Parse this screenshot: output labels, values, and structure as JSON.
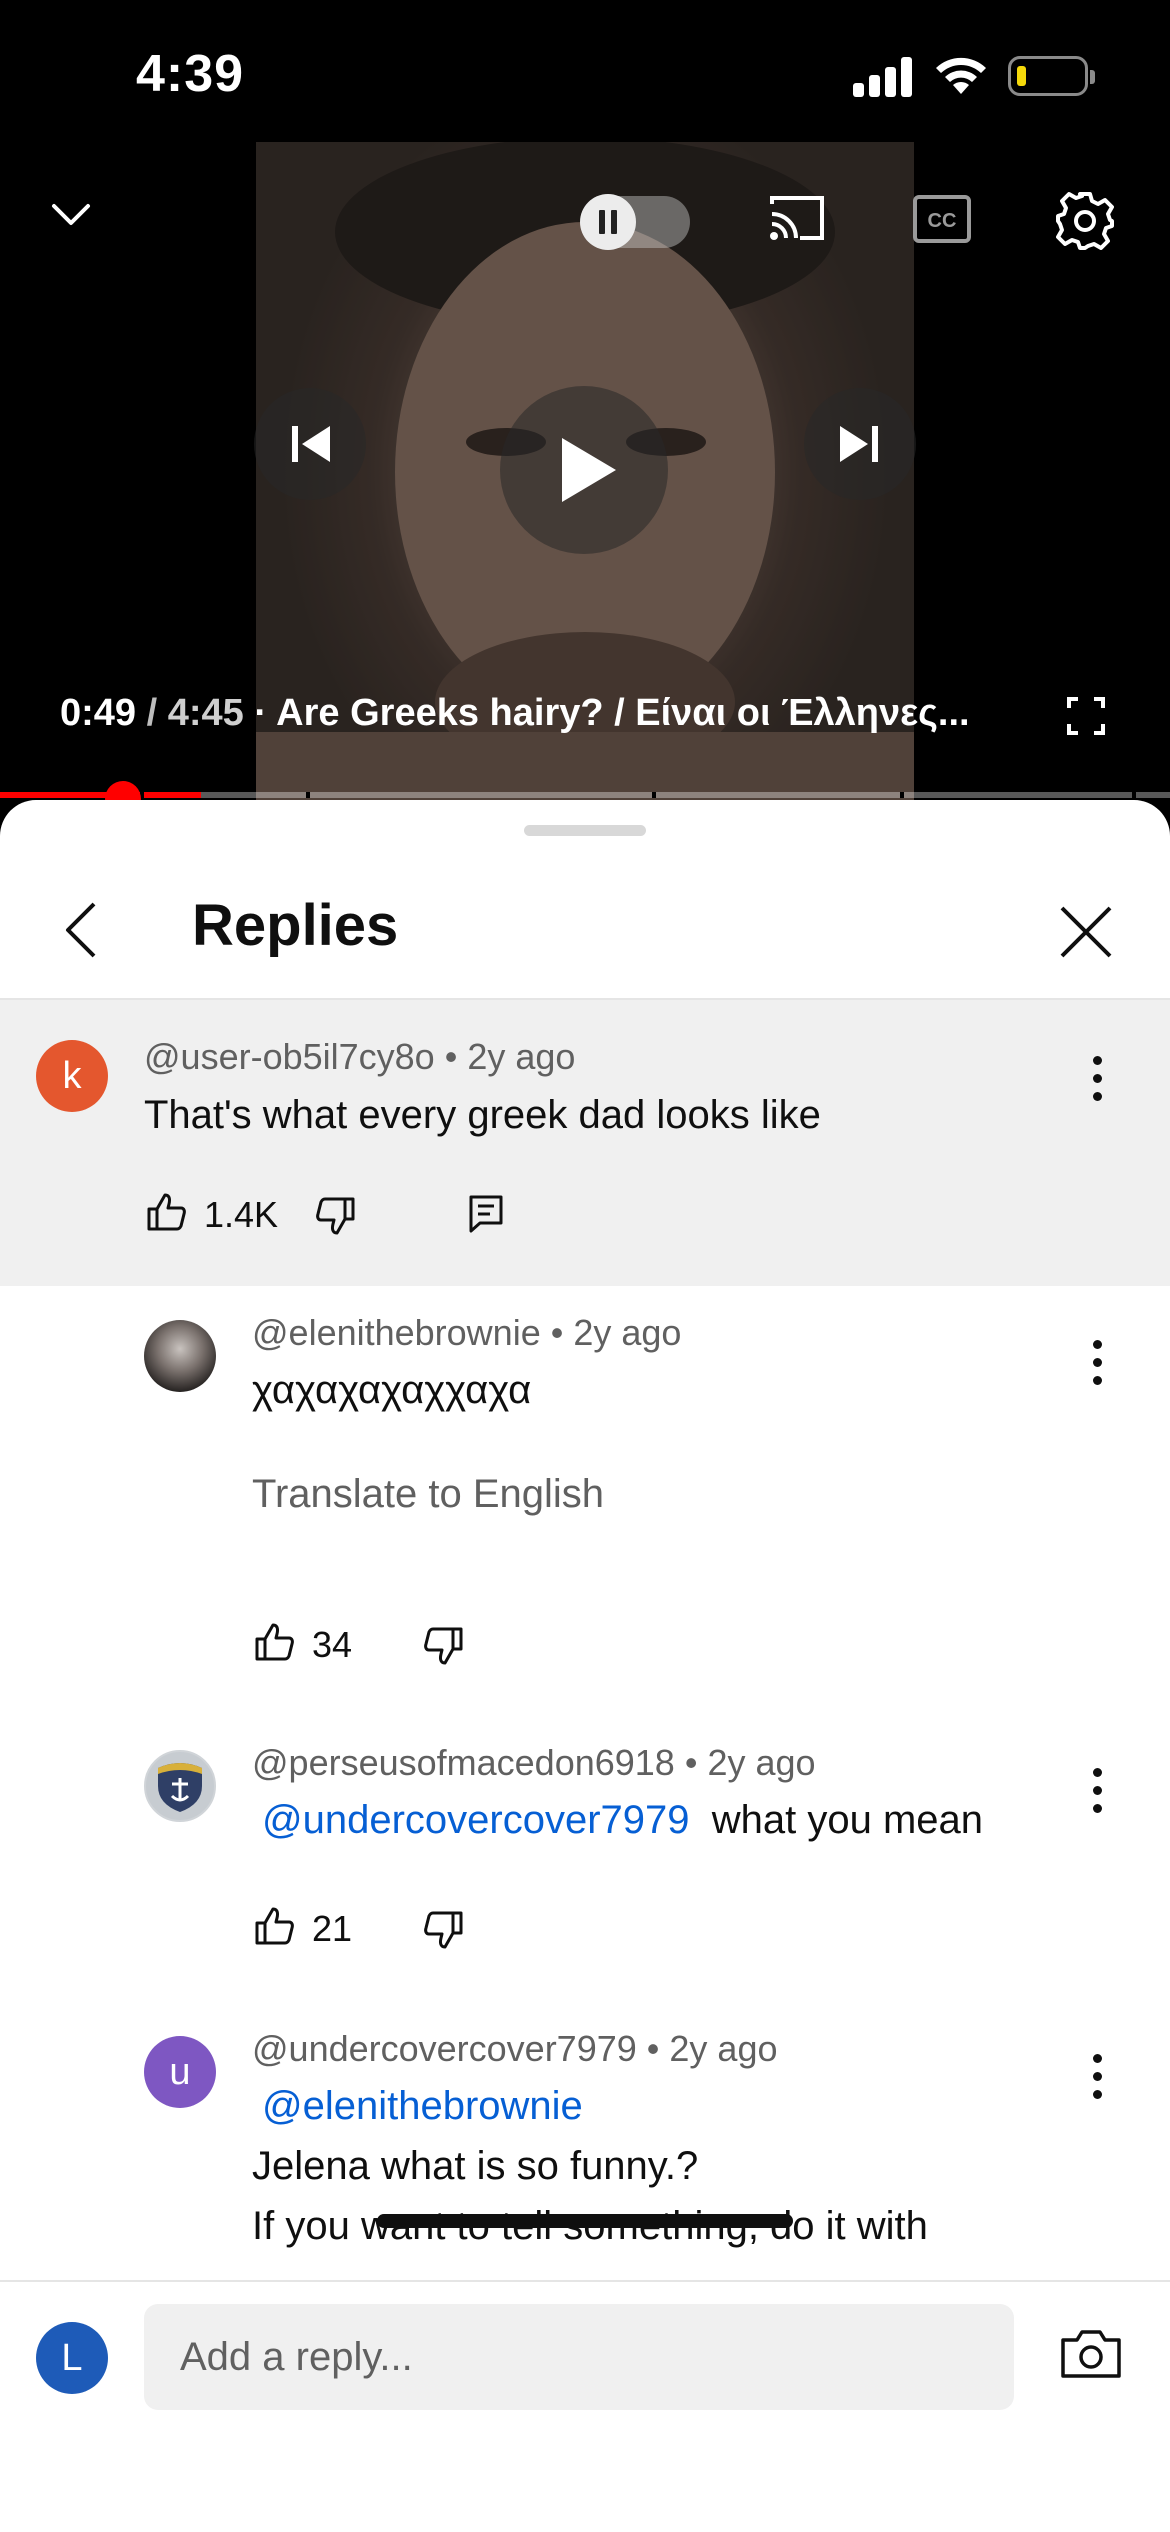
{
  "status_bar": {
    "time": "4:39"
  },
  "player": {
    "current_time": "0:49",
    "separator": "/",
    "duration": "4:45",
    "title": "· Are Greeks hairy? / Είναι οι Έλληνες...",
    "progress_fraction": 0.172,
    "autoplay": "paused",
    "icons": [
      "chevron-down-icon",
      "autoplay-toggle-icon",
      "cast-icon",
      "captions-icon",
      "settings-icon",
      "previous-icon",
      "play-icon",
      "next-icon",
      "fullscreen-icon"
    ],
    "accent_color": "#ff0000"
  },
  "sheet": {
    "title": "Replies",
    "icons": [
      "back-arrow-icon",
      "close-icon"
    ]
  },
  "parent_comment": {
    "avatar_letter": "k",
    "avatar_color": "#e4572e",
    "author": "@user-ob5il7cy8o",
    "age": "• 2y ago",
    "text": "That's what every greek dad looks like",
    "likes": "1.4K"
  },
  "replies": [
    {
      "author": "@elenithebrownie",
      "age": "• 2y ago",
      "text": "χαχαχαχαχχαχα",
      "translate": "Translate to English",
      "likes": "34"
    },
    {
      "author": "@perseusofmacedon6918",
      "age": "• 2y ago",
      "mention": "@undercovercover7979",
      "text": "what you mean",
      "likes": "21"
    },
    {
      "avatar_letter": "u",
      "avatar_color": "#7e57c2",
      "author": "@undercovercover7979",
      "age": "• 2y ago",
      "mention": "@elenithebrownie",
      "line1": "Jelena what is so funny.?",
      "line2": "If you want to tell something, do it with"
    }
  ],
  "reply_bar": {
    "avatar_letter": "L",
    "avatar_color": "#1e5bb8",
    "placeholder": "Add a reply...",
    "icons": [
      "camera-icon"
    ]
  }
}
